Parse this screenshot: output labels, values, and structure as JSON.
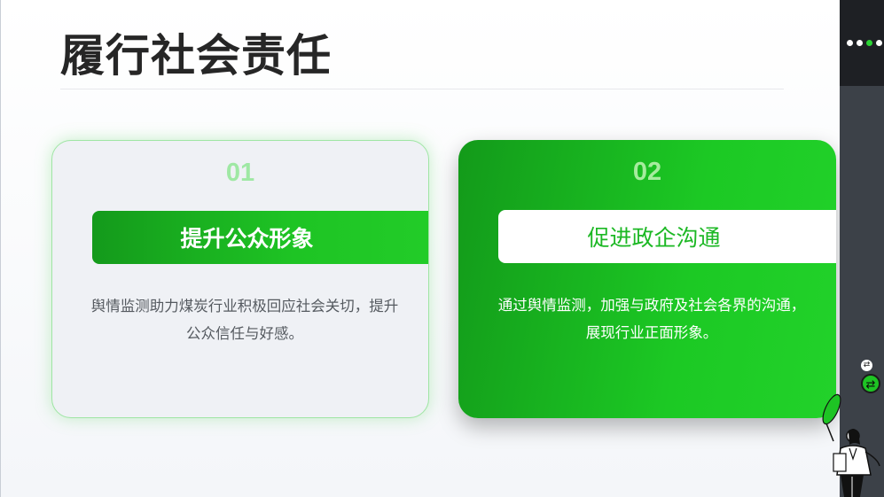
{
  "slide": {
    "title": "履行社会责任"
  },
  "cards": [
    {
      "number": "01",
      "heading": "提升公众形象",
      "description": "舆情监测助力煤炭行业积极回应社会关切，提升公众信任与好感。"
    },
    {
      "number": "02",
      "heading": "促进政企沟通",
      "description": "通过舆情监测，加强与政府及社会各界的沟通，展现行业正面形象。"
    }
  ],
  "sidebar": {
    "menu_icon": "dots-menu-icon",
    "nav_icons": [
      "swap-small-icon",
      "swap-large-icon"
    ]
  },
  "colors": {
    "accent_green": "#1ec424",
    "title": "#262626",
    "sidebar": "#3c4148"
  },
  "illustration": "person-holding-leaf-illustration"
}
